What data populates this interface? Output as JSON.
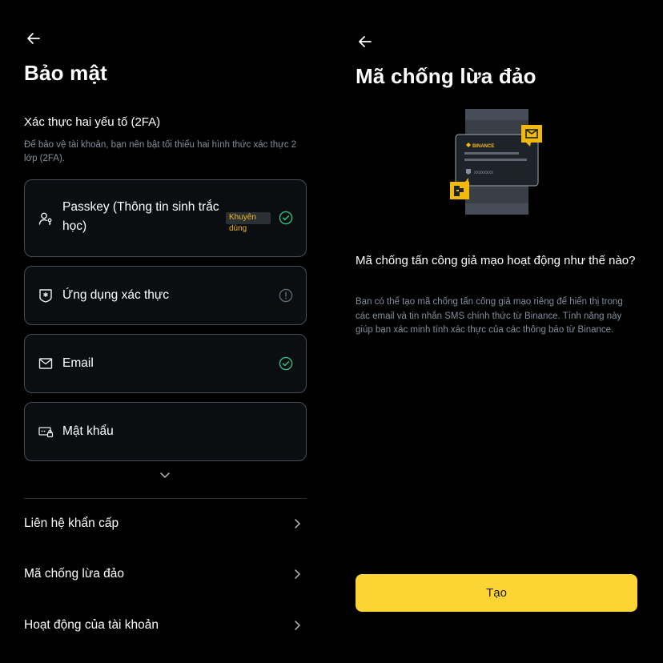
{
  "left": {
    "title": "Bảo mật",
    "section_title": "Xác thực hai yếu tố (2FA)",
    "section_desc": "Để bảo vệ tài khoản, bạn nên bật tối thiểu hai hình thức xác thực 2 lớp (2FA).",
    "methods": [
      {
        "label": "Passkey (Thông tin sinh trắc học)",
        "icon": "passkey-icon",
        "badge": "Khuyên dùng",
        "status": "enabled"
      },
      {
        "label": "Ứng dụng xác thực",
        "icon": "authenticator-icon",
        "status": "warning"
      },
      {
        "label": "Email",
        "icon": "email-icon",
        "status": "enabled"
      },
      {
        "label": "Mật khẩu",
        "icon": "password-icon",
        "status": "none"
      }
    ],
    "rows": [
      {
        "label": "Liên hệ khẩn cấp"
      },
      {
        "label": "Mã chống lừa đảo"
      },
      {
        "label": "Hoạt động của tài khoản"
      }
    ]
  },
  "right": {
    "title": "Mã chống lừa đảo",
    "illustration": {
      "brand": "BINANCE",
      "code": "xxxxxxxx"
    },
    "question": "Mã chống tấn công giả mạo hoạt động như thế nào?",
    "description": "Bạn có thể tạo mã chống tấn công giả mạo riêng để hiển thị trong các email và tin nhắn SMS chính thức từ Binance. Tính năng này giúp bạn xác minh tính xác thực của các thông báo từ Binance.",
    "button": "Tạo"
  },
  "colors": {
    "accent": "#FCD535",
    "brand_yellow": "#F0B90B",
    "success": "#2EBD85",
    "muted": "#848E9C",
    "border": "#474D57"
  }
}
